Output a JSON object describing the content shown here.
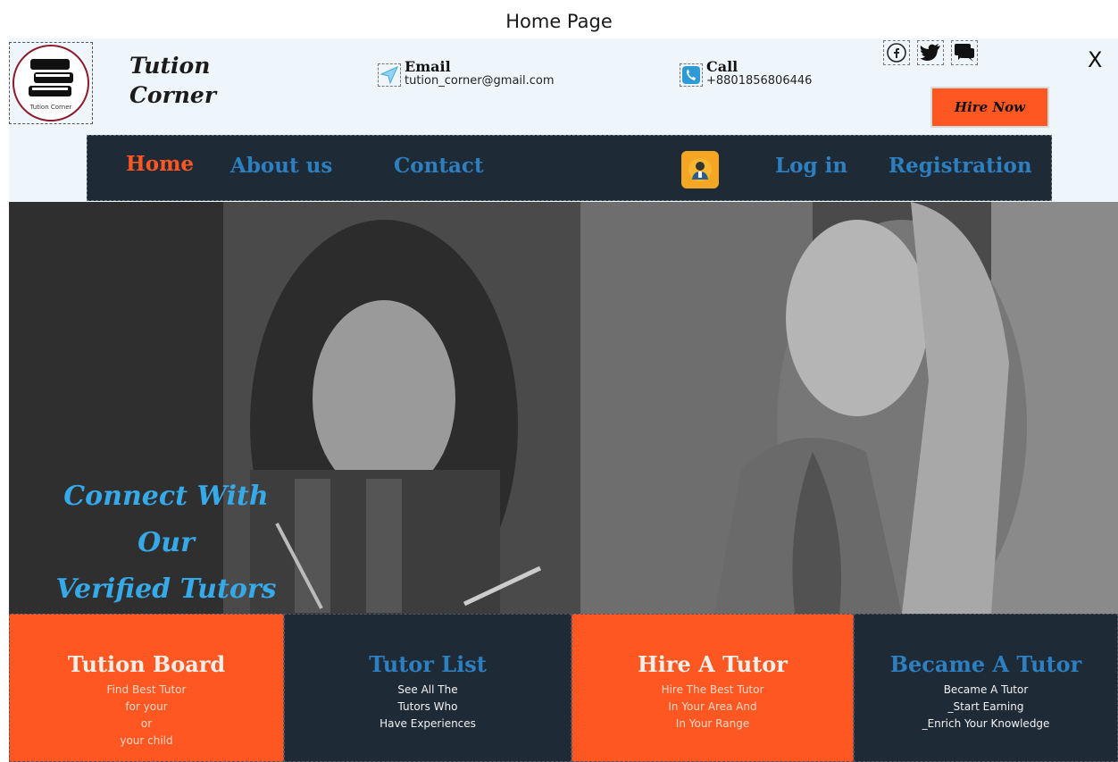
{
  "window": {
    "title": "Home Page",
    "close_label": "X"
  },
  "brand": {
    "logo_text": "Tution Corner",
    "line1": "Tution",
    "line2": "Corner"
  },
  "contact": {
    "email_label": "Email",
    "email_value": "tution_corner@gmail.com",
    "call_label": "Call",
    "call_value": "+8801856806446"
  },
  "socials": [
    "facebook-icon",
    "twitter-icon",
    "chat-icon"
  ],
  "hire_button": "Hire Now",
  "nav": {
    "home": "Home",
    "about": "About us",
    "contact": "Contact",
    "login": "Log in",
    "registration": "Registration"
  },
  "hero": {
    "line1": "Connect With",
    "line2": "Our",
    "line3": "Verified Tutors"
  },
  "features": [
    {
      "title": "Tution Board",
      "desc": [
        "Find Best Tutor",
        "for your",
        "or",
        "your child"
      ]
    },
    {
      "title": "Tutor List",
      "desc": [
        "See All The",
        "Tutors Who",
        "Have Experiences"
      ]
    },
    {
      "title": "Hire A Tutor",
      "desc": [
        "Hire The Best Tutor",
        "In Your Area And",
        "In Your Range"
      ]
    },
    {
      "title": "Became A Tutor",
      "desc": [
        "Became A Tutor",
        "_Start Earning",
        "_Enrich Your Knowledge"
      ]
    }
  ],
  "colors": {
    "accent": "#ff5722",
    "navy": "#1f2a37",
    "blue": "#2d7fc0",
    "hero_text": "#36a9e8"
  }
}
